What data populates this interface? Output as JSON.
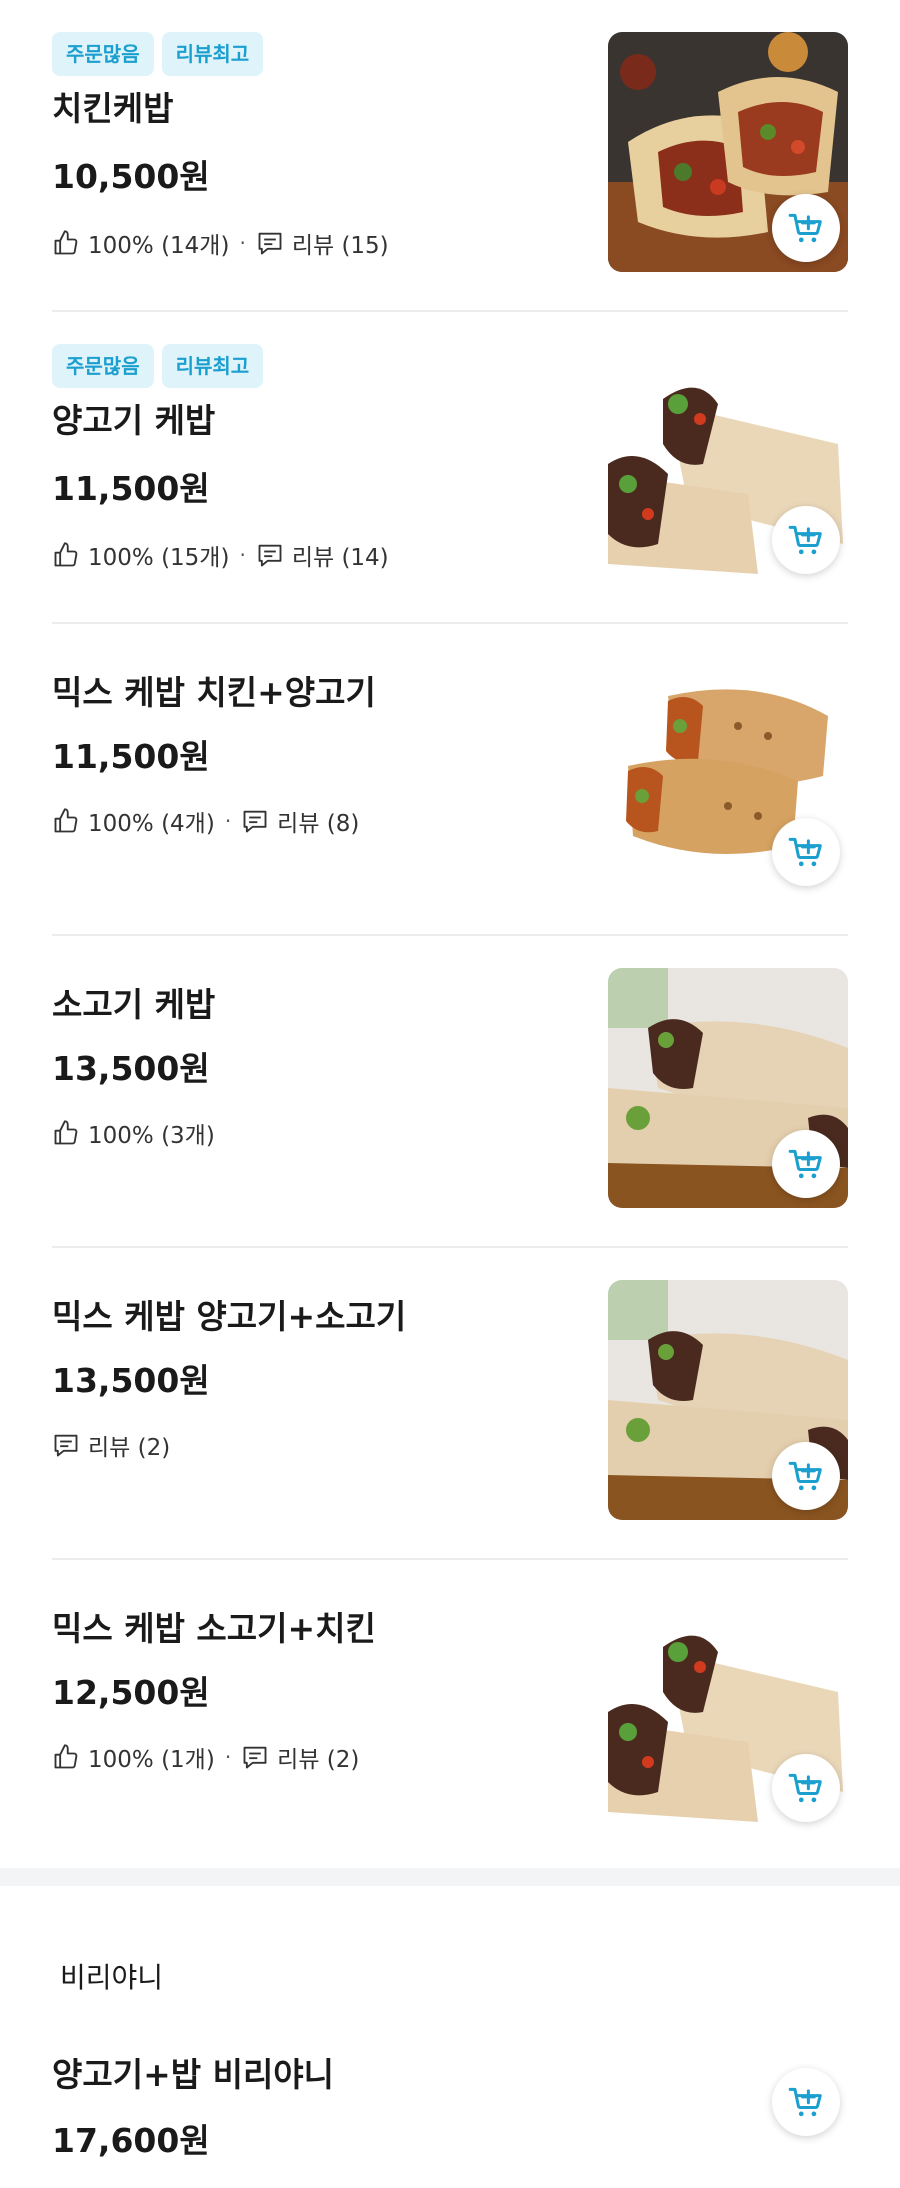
{
  "items": [
    {
      "badges": [
        "주문많음",
        "리뷰최고"
      ],
      "name": "치킨케밥",
      "price": "10,500원",
      "like": "100% (14개)",
      "review": "리뷰 (15)"
    },
    {
      "badges": [
        "주문많음",
        "리뷰최고"
      ],
      "name": "양고기 케밥",
      "price": "11,500원",
      "like": "100% (15개)",
      "review": "리뷰 (14)"
    },
    {
      "name": "믹스 케밥 치킨+양고기",
      "price": "11,500원",
      "like": "100% (4개)",
      "review": "리뷰 (8)"
    },
    {
      "name": "소고기 케밥",
      "price": "13,500원",
      "like": "100% (3개)"
    },
    {
      "name": "믹스 케밥 양고기+소고기",
      "price": "13,500원",
      "review": "리뷰 (2)"
    },
    {
      "name": "믹스 케밥 소고기+치킨",
      "price": "12,500원",
      "like": "100% (1개)",
      "review": "리뷰 (2)"
    }
  ],
  "section": {
    "title": "비리야니",
    "items": [
      {
        "name": "양고기+밥 비리야니",
        "price": "17,600원"
      }
    ]
  },
  "colors": {
    "accent": "#1b9fcf",
    "badge_bg": "#dff3fb",
    "divider": "#ececec",
    "section_bg": "#f2f4f6"
  },
  "icons": {
    "like": "thumbs-up-icon",
    "review": "comment-icon",
    "cart": "add-to-cart-icon"
  }
}
